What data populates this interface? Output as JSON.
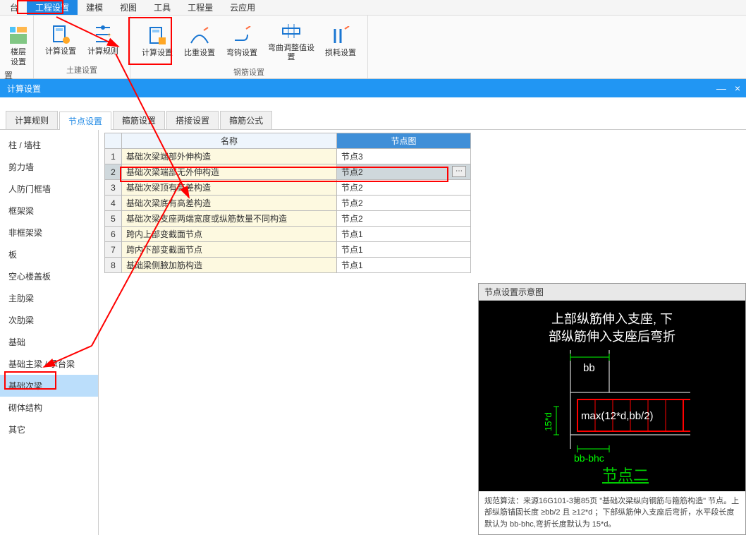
{
  "menu": {
    "items": [
      "台",
      "工程设置",
      "建模",
      "视图",
      "工具",
      "工程量",
      "云应用"
    ],
    "active_index": 1
  },
  "ribbon": {
    "groups": [
      {
        "label": "",
        "buttons": [
          {
            "label": "楼层设置",
            "icon": "layers"
          }
        ]
      },
      {
        "label": "土建设置",
        "buttons": [
          {
            "label": "计算设置",
            "icon": "calc-civil"
          },
          {
            "label": "计算规则",
            "icon": "rules"
          }
        ]
      },
      {
        "label": "钢筋设置",
        "buttons": [
          {
            "label": "计算设置",
            "icon": "calc-rebar"
          },
          {
            "label": "比重设置",
            "icon": "weight"
          },
          {
            "label": "弯钩设置",
            "icon": "hook"
          },
          {
            "label": "弯曲调整值设置",
            "icon": "bend"
          },
          {
            "label": "损耗设置",
            "icon": "loss"
          }
        ]
      },
      {
        "label": "",
        "buttons": [
          {
            "label": "置",
            "icon": "cfg"
          }
        ]
      }
    ]
  },
  "dialog": {
    "title": "计算设置",
    "min": "—",
    "close": "×"
  },
  "subtabs": {
    "items": [
      "计算规则",
      "节点设置",
      "箍筋设置",
      "搭接设置",
      "箍筋公式"
    ],
    "active_index": 1
  },
  "categories": {
    "items": [
      "柱 / 墙柱",
      "剪力墙",
      "人防门框墙",
      "框架梁",
      "非框架梁",
      "板",
      "空心楼盖板",
      "主肋梁",
      "次肋梁",
      "基础",
      "基础主梁 / 承台梁",
      "基础次梁",
      "砌体结构",
      "其它"
    ],
    "active_index": 11
  },
  "grid": {
    "headers": {
      "name": "名称",
      "node": "节点图"
    },
    "rows": [
      {
        "n": 1,
        "name": "基础次梁端部外伸构造",
        "node": "节点3"
      },
      {
        "n": 2,
        "name": "基础次梁端部无外伸构造",
        "node": "节点2"
      },
      {
        "n": 3,
        "name": "基础次梁顶有高差构造",
        "node": "节点2"
      },
      {
        "n": 4,
        "name": "基础次梁底有高差构造",
        "node": "节点2"
      },
      {
        "n": 5,
        "name": "基础次梁支座两端宽度或纵筋数量不同构造",
        "node": "节点2"
      },
      {
        "n": 6,
        "name": "跨内上部变截面节点",
        "node": "节点1"
      },
      {
        "n": 7,
        "name": "跨内下部变截面节点",
        "node": "节点1"
      },
      {
        "n": 8,
        "name": "基础梁侧腋加筋构造",
        "node": "节点1"
      }
    ],
    "selected_row": 1
  },
  "diagram": {
    "header": "节点设置示意图",
    "title_line1": "上部纵筋伸入支座, 下",
    "title_line2": "部纵筋伸入支座后弯折",
    "bb": "bb",
    "formula": "max(12*d,bb/2)",
    "dim": "15*d",
    "bottom_dim": "bb-bhc",
    "node_label": "节点二",
    "note": "规范算法：来源16G101-3第85页 \"基础次梁纵向钢筋与箍筋构造\" 节点。上部纵筋锚固长度 ≥bb/2 且 ≥12*d ；下部纵筋伸入支座后弯折，水平段长度默认为 bb-bhc,弯折长度默认为 15*d。"
  }
}
